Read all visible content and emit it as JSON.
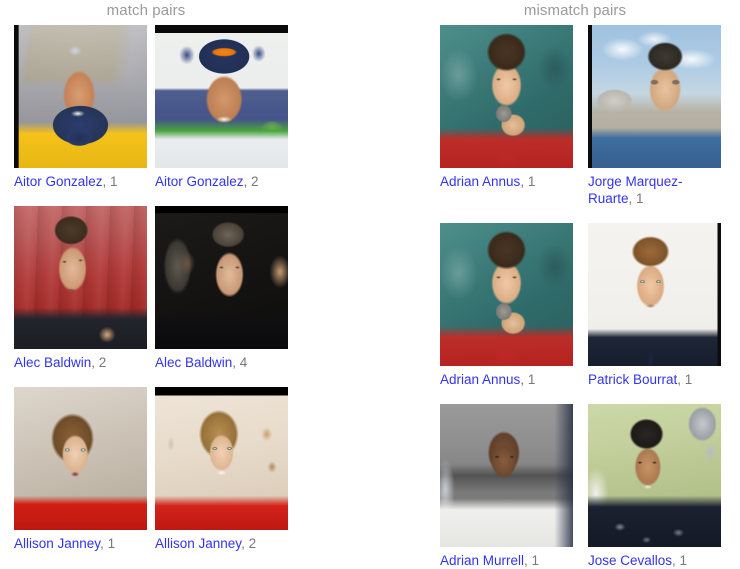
{
  "columns": [
    {
      "header": "match pairs",
      "rows": [
        {
          "left": {
            "person": "Aitor Gonzalez",
            "index": ", 1"
          },
          "right": {
            "person": "Aitor Gonzalez",
            "index": ", 2"
          }
        },
        {
          "left": {
            "person": "Alec Baldwin",
            "index": ", 2"
          },
          "right": {
            "person": "Alec Baldwin",
            "index": ", 4"
          }
        },
        {
          "left": {
            "person": "Allison Janney",
            "index": ", 1"
          },
          "right": {
            "person": "Allison Janney",
            "index": ", 2"
          }
        }
      ]
    },
    {
      "header": "mismatch pairs",
      "rows": [
        {
          "left": {
            "person": "Adrian Annus",
            "index": ", 1"
          },
          "right": {
            "person": "Jorge Marquez-Ruarte",
            "index": ", 1"
          }
        },
        {
          "left": {
            "person": "Adrian Annus",
            "index": ", 1"
          },
          "right": {
            "person": "Patrick Bourrat",
            "index": ", 1"
          }
        },
        {
          "left": {
            "person": "Adrian Murrell",
            "index": ", 1"
          },
          "right": {
            "person": "Jose Cevallos",
            "index": ", 1"
          }
        }
      ]
    }
  ],
  "colors": {
    "header_text": "#9a9a9a",
    "person_link": "#3333ee",
    "index_text": "#777777",
    "background": "#ffffff"
  },
  "photos": {
    "aitor_gonzalez_1": "cyclist in yellow jersey wearing dark blue cap, holding trophy",
    "aitor_gonzalez_2": "cyclist in green and white jersey with orange sunglasses on cap",
    "alec_baldwin_2": "man in dark suit in front of red curtain",
    "alec_baldwin_4": "man in dark jacket at night with dark background",
    "allison_janney_1": "woman with brown hair in red dress, surprised expression",
    "allison_janney_2": "woman with blonde hair in red dress smiling at event backdrop",
    "adrian_annus_1": "athlete holding shot put to face, teal background, red singlet",
    "jorge_marquez_ruarte_1": "older man with glasses in blue shirt against cloudy sky",
    "patrick_bourrat_1": "man in dark suit and tie on white background",
    "adrian_murrell_1": "athlete in white jersey against grey background",
    "jose_cevallos_1": "man in dark patterned jacket on green field with trophy"
  }
}
